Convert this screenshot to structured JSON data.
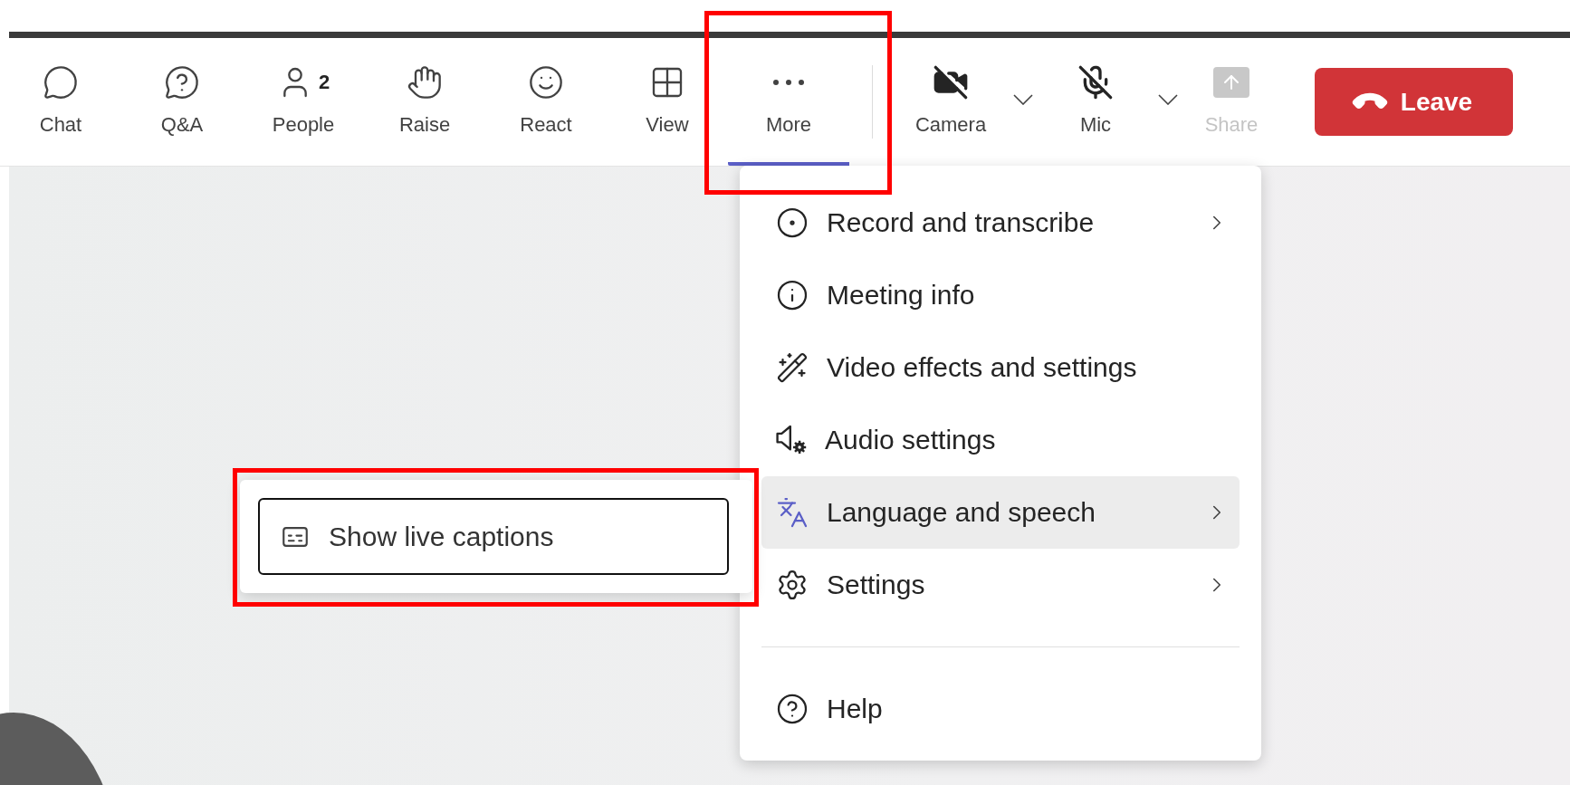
{
  "toolbar": {
    "main_buttons": [
      {
        "label": "Chat",
        "active": false
      },
      {
        "label": "Q&A",
        "active": false
      },
      {
        "label": "People",
        "count": "2",
        "active": false
      },
      {
        "label": "Raise",
        "active": false
      },
      {
        "label": "React",
        "active": false
      },
      {
        "label": "View",
        "active": false
      },
      {
        "label": "More",
        "active": true
      }
    ],
    "device_buttons": [
      {
        "label": "Camera",
        "kind": "split",
        "disabled": false
      },
      {
        "label": "Mic",
        "kind": "split",
        "disabled": false
      },
      {
        "label": "Share",
        "kind": "plain",
        "disabled": true
      }
    ],
    "leave_button": {
      "label": "Leave"
    }
  },
  "more_menu": {
    "items": [
      {
        "label": "Record and transcribe",
        "has_submenu": true,
        "selected": false
      },
      {
        "label": "Meeting info",
        "has_submenu": false,
        "selected": false
      },
      {
        "label": "Video effects and settings",
        "has_submenu": false,
        "selected": false
      },
      {
        "label": "Audio settings",
        "has_submenu": false,
        "selected": false
      },
      {
        "label": "Language and speech",
        "has_submenu": true,
        "selected": true
      },
      {
        "label": "Settings",
        "has_submenu": true,
        "selected": false
      }
    ],
    "footer_items": [
      {
        "label": "Help",
        "has_submenu": false,
        "selected": false
      }
    ]
  },
  "submenu": {
    "items": [
      {
        "label": "Show live captions",
        "focused": true
      }
    ]
  },
  "highlights": {
    "more_button": true,
    "captions_submenu": true
  }
}
